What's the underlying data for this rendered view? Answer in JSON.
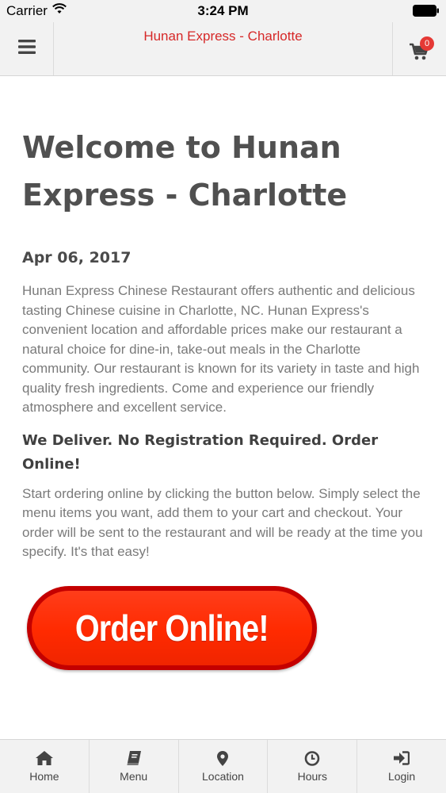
{
  "status_bar": {
    "carrier": "Carrier",
    "time": "3:24 PM"
  },
  "header": {
    "title": "Hunan Express - Charlotte",
    "cart_count": "0"
  },
  "main": {
    "title": "Welcome to Hunan Express - Charlotte",
    "date": "Apr 06, 2017",
    "intro": "Hunan Express Chinese Restaurant offers authentic and delicious tasting Chinese cuisine in Charlotte, NC. Hunan Express's convenient location and affordable prices make our restaurant a natural choice for dine-in, take-out meals in the Charlotte community. Our restaurant is known for its variety in taste and high quality fresh ingredients. Come and experience our friendly atmosphere and excellent service.",
    "deliver_heading": "We Deliver. No Registration Required. Order Online!",
    "instructions": "Start ordering online by clicking the button below. Simply select the menu items you want, add them to your cart and checkout. Your order will be sent to the restaurant and will be ready at the time you specify. It's that easy!",
    "order_button_label": "Order Online!"
  },
  "tabs": [
    {
      "label": "Home",
      "icon": "home-icon"
    },
    {
      "label": "Menu",
      "icon": "book-icon"
    },
    {
      "label": "Location",
      "icon": "map-marker-icon"
    },
    {
      "label": "Hours",
      "icon": "clock-icon"
    },
    {
      "label": "Login",
      "icon": "sign-in-icon"
    }
  ],
  "colors": {
    "accent": "#d62828",
    "badge": "#e53935",
    "order_button": "#ff2a00"
  }
}
